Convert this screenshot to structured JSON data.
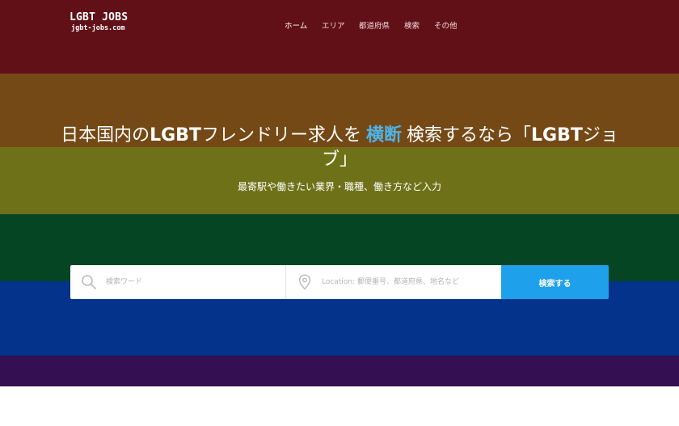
{
  "brand": {
    "title": "LGBT JOBS",
    "domain": "jgbt-jobs.com"
  },
  "nav": {
    "items": [
      {
        "label": "ホーム",
        "active": true
      },
      {
        "label": "エリア"
      },
      {
        "label": "都道府県"
      },
      {
        "label": "検索"
      },
      {
        "label": "その他"
      }
    ]
  },
  "hero": {
    "headline_part1": "日本国内の",
    "headline_lgbt1": "LGBT",
    "headline_part2": "フレンドリー求人を",
    "headline_accent": "横断",
    "headline_part3": "検索するなら「",
    "headline_lgbt2": "LGBT",
    "headline_part4": "ジョブ」",
    "subline": "最寄駅や働きたい業界・職種、働き方など入力",
    "stripe_colors": [
      "#611018",
      "#744916",
      "#6f7118",
      "#054524",
      "#03338a",
      "#340f51"
    ]
  },
  "search": {
    "keyword_placeholder": "検索ワード",
    "location_placeholder": "Location: 郵便番号、都道府県、地名など",
    "button_label": "検索する",
    "accent_color": "#1ea0ea"
  }
}
